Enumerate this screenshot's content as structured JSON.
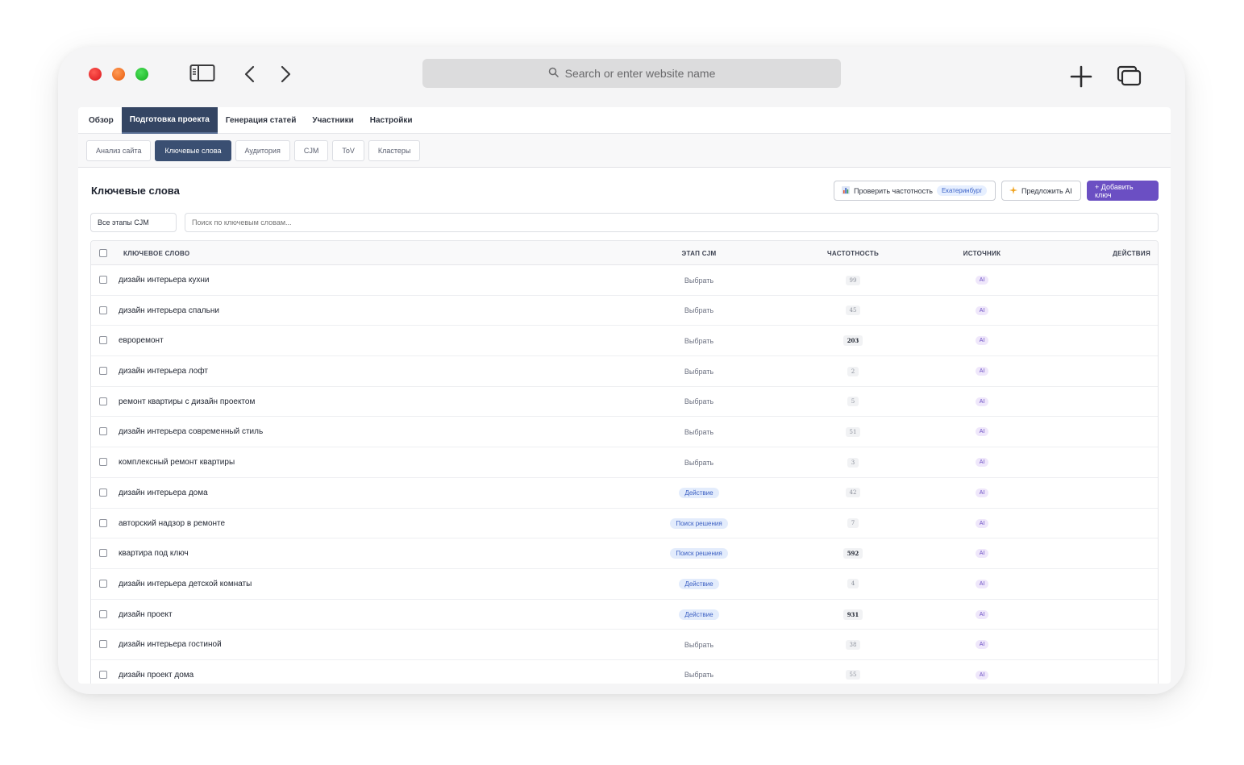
{
  "browser": {
    "url_placeholder": "Search or enter website name"
  },
  "main_tabs": [
    {
      "label": "Обзор",
      "active": false
    },
    {
      "label": "Подготовка проекта",
      "active": true
    },
    {
      "label": "Генерация статей",
      "active": false
    },
    {
      "label": "Участники",
      "active": false
    },
    {
      "label": "Настройки",
      "active": false
    }
  ],
  "sub_tabs": [
    {
      "label": "Анализ сайта",
      "active": false
    },
    {
      "label": "Ключевые слова",
      "active": true
    },
    {
      "label": "Аудитория",
      "active": false
    },
    {
      "label": "CJM",
      "active": false
    },
    {
      "label": "ToV",
      "active": false
    },
    {
      "label": "Кластеры",
      "active": false
    }
  ],
  "section": {
    "title": "Ключевые слова",
    "check_frequency_label": "Проверить частотность",
    "city": "Екатеринбург",
    "suggest_ai_label": "Предложить AI",
    "add_key_label": "+ Добавить ключ"
  },
  "filters": {
    "stage_select_value": "Все этапы CJM",
    "search_placeholder": "Поиск по ключевым словам..."
  },
  "table": {
    "headers": {
      "keyword": "Ключевое слово",
      "stage": "Этап CJM",
      "frequency": "Частотность",
      "source": "Источник",
      "actions": "Действия"
    },
    "rows": [
      {
        "keyword": "дизайн интерьера кухни",
        "stage": "Выбрать",
        "stage_chip": false,
        "frequency": "99",
        "source": "AI"
      },
      {
        "keyword": "дизайн интерьера спальни",
        "stage": "Выбрать",
        "stage_chip": false,
        "frequency": "45",
        "source": "AI"
      },
      {
        "keyword": "евроремонт",
        "stage": "Выбрать",
        "stage_chip": false,
        "frequency": "203",
        "source": "AI"
      },
      {
        "keyword": "дизайн интерьера лофт",
        "stage": "Выбрать",
        "stage_chip": false,
        "frequency": "2",
        "source": "AI"
      },
      {
        "keyword": "ремонт квартиры с дизайн проектом",
        "stage": "Выбрать",
        "stage_chip": false,
        "frequency": "5",
        "source": "AI"
      },
      {
        "keyword": "дизайн интерьера современный стиль",
        "stage": "Выбрать",
        "stage_chip": false,
        "frequency": "51",
        "source": "AI"
      },
      {
        "keyword": "комплексный ремонт квартиры",
        "stage": "Выбрать",
        "stage_chip": false,
        "frequency": "3",
        "source": "AI"
      },
      {
        "keyword": "дизайн интерьера дома",
        "stage": "Действие",
        "stage_chip": true,
        "frequency": "42",
        "source": "AI"
      },
      {
        "keyword": "авторский надзор в ремонте",
        "stage": "Поиск решения",
        "stage_chip": true,
        "frequency": "7",
        "source": "AI"
      },
      {
        "keyword": "квартира под ключ",
        "stage": "Поиск решения",
        "stage_chip": true,
        "frequency": "592",
        "source": "AI"
      },
      {
        "keyword": "дизайн интерьера детской комнаты",
        "stage": "Действие",
        "stage_chip": true,
        "frequency": "4",
        "source": "AI"
      },
      {
        "keyword": "дизайн проект",
        "stage": "Действие",
        "stage_chip": true,
        "frequency": "931",
        "source": "AI"
      },
      {
        "keyword": "дизайн интерьера гостиной",
        "stage": "Выбрать",
        "stage_chip": false,
        "frequency": "38",
        "source": "AI"
      },
      {
        "keyword": "дизайн проект дома",
        "stage": "Выбрать",
        "stage_chip": false,
        "frequency": "55",
        "source": "AI"
      }
    ]
  },
  "colors": {
    "primary_dark": "#344563",
    "accent_purple": "#6b4fc3",
    "stage_chip_bg": "#e3ecfc",
    "ai_chip_bg": "#efe7fb"
  },
  "icons": {
    "sidebar": "sidebar-icon",
    "back": "chevron-left-icon",
    "forward": "chevron-right-icon",
    "search": "search-icon",
    "new_tab": "plus-icon",
    "tabs": "tabs-overview-icon",
    "chart": "bar-chart-icon",
    "sparkle": "sparkle-icon"
  }
}
